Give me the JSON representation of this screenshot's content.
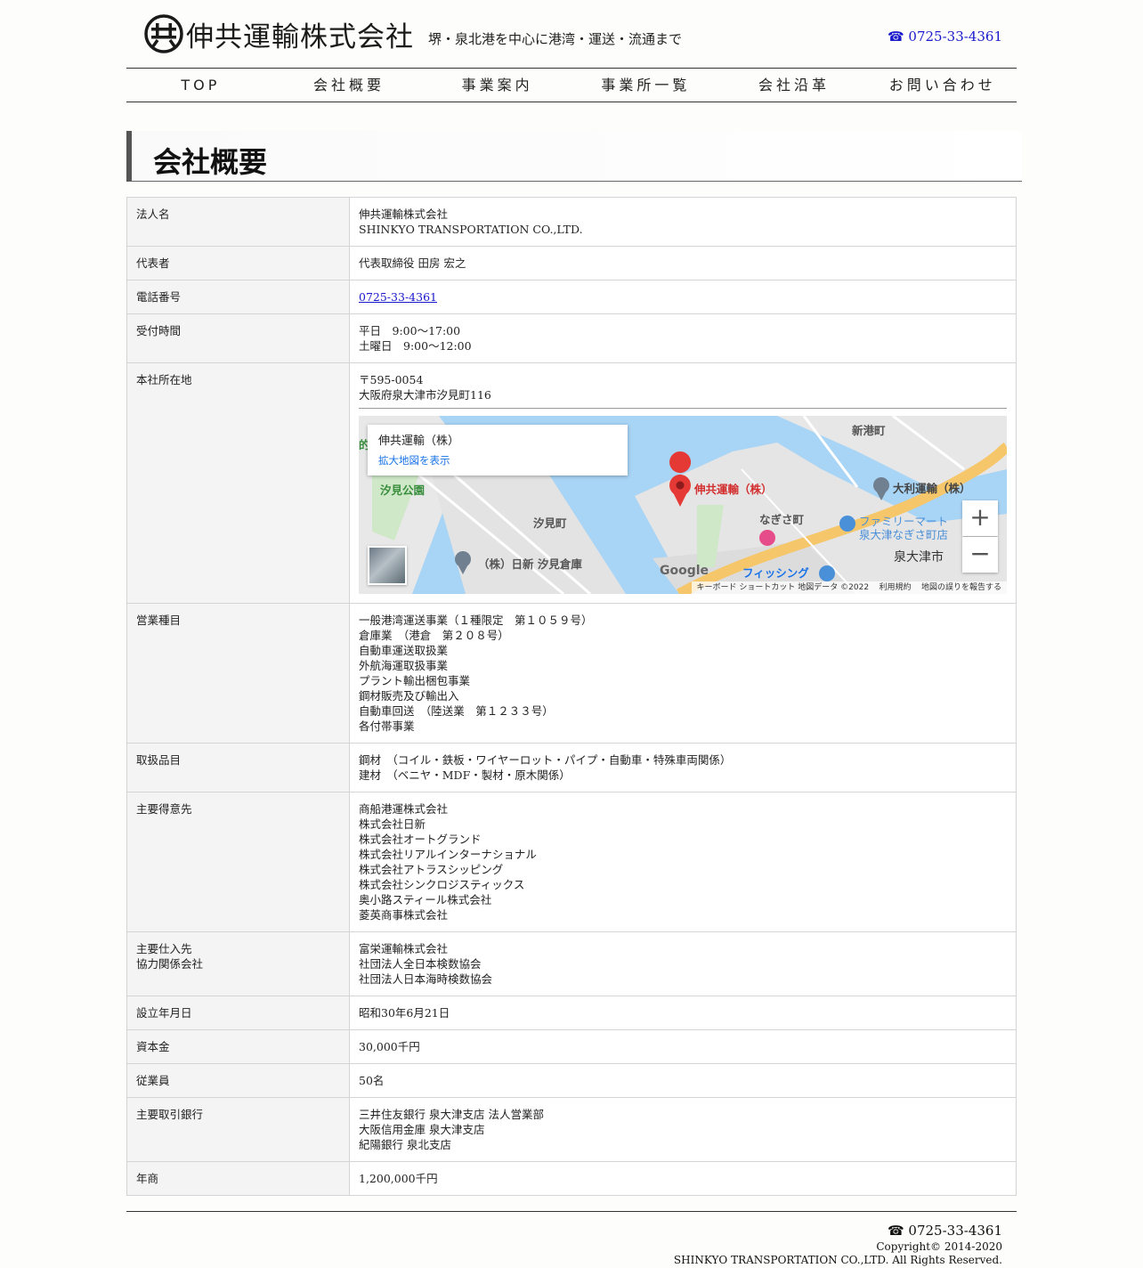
{
  "header": {
    "logo_text": "伸共運輸株式会社",
    "tagline": "堺・泉北港を中心に港湾・運送・流通まで",
    "phone": "☎ 0725-33-4361"
  },
  "nav": {
    "items": [
      "TOP",
      "会社概要",
      "事業案内",
      "事業所一覧",
      "会社沿革",
      "お問い合わせ"
    ]
  },
  "page_title": "会社概要",
  "table": {
    "rows": [
      {
        "label": "法人名",
        "lines": [
          "伸共運輸株式会社",
          "SHINKYO TRANSPORTATION CO.,LTD."
        ]
      },
      {
        "label": "代表者",
        "lines": [
          "代表取締役 田房 宏之"
        ]
      },
      {
        "label": "電話番号",
        "link": "0725-33-4361"
      },
      {
        "label": "受付時間",
        "lines": [
          "平日　9:00～17:00",
          "土曜日　9:00～12:00"
        ]
      },
      {
        "label": "本社所在地",
        "lines": [
          "〒595-0054",
          "大阪府泉大津市汐見町116"
        ]
      },
      {
        "label": "営業種目",
        "lines": [
          "一般港湾運送事業（１種限定　第１０５９号）",
          "倉庫業　（港倉　第２０８号）",
          "自動車運送取扱業",
          "外航海運取扱事業",
          "プラント輸出梱包事業",
          "鋼材販売及び輸出入",
          "自動車回送　（陸送業　第１２３３号）",
          "各付帯事業"
        ]
      },
      {
        "label": "取扱品目",
        "lines": [
          "鋼材　（コイル・鉄板・ワイヤーロット・パイプ・自動車・特殊車両関係）",
          "建材　（ベニヤ・MDF・製材・原木関係）"
        ]
      },
      {
        "label": "主要得意先",
        "lines": [
          "商船港運株式会社",
          "株式会社日新",
          "株式会社オートグランド",
          "株式会社リアルインターナショナル",
          "株式会社アトラスシッピング",
          "株式会社シンクロジスティックス",
          "奥小路スティール株式会社",
          "菱英商事株式会社"
        ]
      },
      {
        "label_lines": [
          "主要仕入先",
          "協力関係会社"
        ],
        "lines": [
          "富栄運輸株式会社",
          "社団法人全日本検数協会",
          "社団法人日本海時検数協会"
        ]
      },
      {
        "label": "設立年月日",
        "lines": [
          "昭和30年6月21日"
        ]
      },
      {
        "label": "資本金",
        "lines": [
          "30,000千円"
        ]
      },
      {
        "label": "従業員",
        "lines": [
          "50名"
        ]
      },
      {
        "label": "主要取引銀行",
        "lines": [
          "三井住友銀行 泉大津支店 法人営業部",
          "大阪信用金庫 泉大津支店",
          "紀陽銀行 泉北支店"
        ]
      },
      {
        "label": "年商",
        "lines": [
          "1,200,000千円"
        ]
      }
    ]
  },
  "map": {
    "card_title": "伸共運輸（株）",
    "card_link": "拡大地図を表示",
    "labels": {
      "pin": "伸共運輸（株）",
      "shinko": "新港町",
      "daiichi": "大利運輸（株）",
      "shiomi_park": "汐見公園",
      "shiomi": "汐見町",
      "nagisa": "なぎさ町",
      "familymart1": "ファミリーマート",
      "familymart2": "泉大津なぎさ町店",
      "nissin": "（株）日新 汐見倉庫",
      "izumiotsu": "泉大津市",
      "fishing": "フィッシング",
      "partial": "的"
    },
    "google": "Google",
    "zoom_in": "+",
    "zoom_out": "−",
    "footer_keyboard": "キーボード ショートカット",
    "footer_data": "地図データ ©2022",
    "footer_terms": "利用規約",
    "footer_report": "地図の誤りを報告する"
  },
  "footer": {
    "phone": "☎ 0725-33-4361",
    "copyright": "Copyright© 2014-2020",
    "rights": "SHINKYO TRANSPORTATION CO.,LTD. All Rights Reserved."
  }
}
